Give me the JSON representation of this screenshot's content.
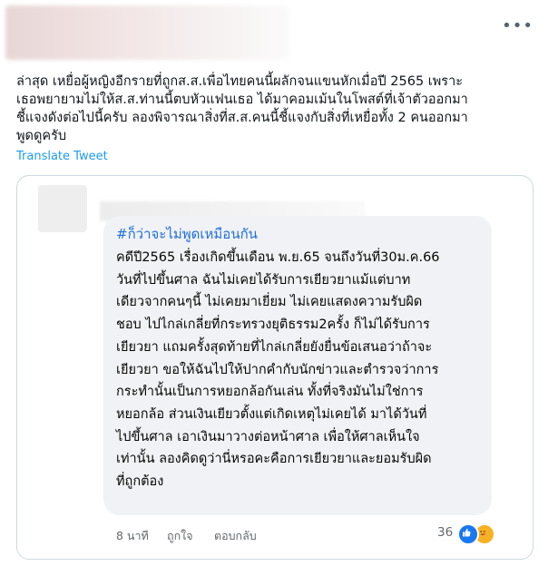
{
  "tweet": {
    "text": "ล่าสุด เหยื่อผู้หญิงอีกรายที่ถูกส.ส.เพื่อไทยคนนี้ผลักจนแขนหักเมื่อปี 2565 เพราะ\nเธอพยายามไม่ให้ส.ส.ท่านนี้ตบหัวแฟนเธอ ได้มาคอมเม้นในโพสต์ที่เจ้าตัวออกมา\nชี้แจงดังต่อไปนี้ครับ ลองพิจารณาสิ่งที่ส.ส.คนนี้ชี้แจงกับสิ่งที่เหยื่อทั้ง 2 คนออกมา\nพูดดูครับ",
    "translate_label": "Translate Tweet"
  },
  "quote": {
    "hashtag": "#ก็ว่าจะไม่พูดเหมือนกัน",
    "text": "คดีปี2565 เรื่องเกิดขึ้นเดือน พ.ย.65 จนถึงวันที่30ม.ค.66\nวันที่ไปขึ้นศาล ฉันไม่เคยได้รับการเยียวยาแม้แต่บาท\nเดียวจากคนๆนี้ ไม่เคยมาเยี่ยม ไม่เคยแสดงความรับผิด\nชอบ ไปไกล่เกลี่ยที่กระทรวงยุติธรรม2ครั้ง ก็ไม่ได้รับการ\nเยียวยา แถมครั้งสุดท้ายที่ไกล่เกลี่ยยังยื่นข้อเสนอว่าถ้าจะ\nเยียวยา ขอให้ฉันไปให้ปากคำกับนักข่าวและตำรวจว่าการ\nกระทำนั้นเป็นการหยอกล้อกันเล่น ทั้งที่จริงมันไม่ใช่การ\nหยอกล้อ ส่วนเงินเยียวตั้งแต่เกิดเหตุไม่เคยได้ มาได้วันที่\nไปขึ้นศาล เอาเงินมาวางต่อหน้าศาล เพื่อให้ศาลเห็นใจ\nเท่านั้น ลองคิดดูว่านี่หรอคะคือการเยียวยาและยอมรับผิด\nที่ถูกต้อง",
    "time": "8 นาที",
    "like_label": "ถูกใจ",
    "reply_label": "ตอบกลับ",
    "reaction_count": "36",
    "reactions": [
      "like-icon",
      "care-icon"
    ],
    "colors": {
      "hashtag": "#216fdb",
      "like": "#1877f2",
      "care": "#f7b125"
    }
  },
  "icons": {
    "more": "more-icon"
  }
}
